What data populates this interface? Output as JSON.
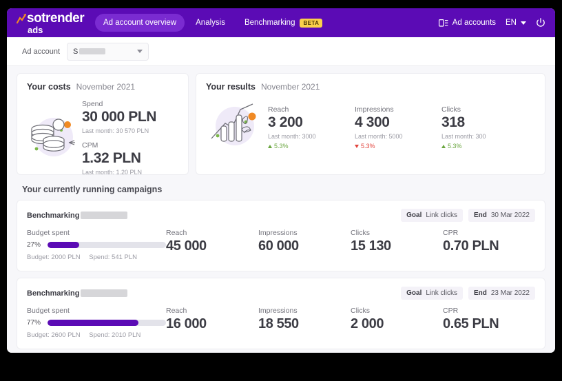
{
  "brand": {
    "logo_main": "sotrender",
    "logo_sub": "ads",
    "accent_purple": "#5b0bb5",
    "accent_orange": "#f08a24",
    "accent_green": "#6aa63f",
    "badge_yellow": "#fbd04b"
  },
  "nav": {
    "items": [
      {
        "label": "Ad account overview",
        "active": true
      },
      {
        "label": "Analysis",
        "active": false
      },
      {
        "label": "Benchmarking",
        "active": false,
        "badge": "BETA"
      }
    ],
    "right": {
      "ad_accounts_label": "Ad accounts",
      "ad_accounts_icon": "list-icon",
      "language": "EN",
      "power_icon": "power-icon"
    }
  },
  "account_bar": {
    "label": "Ad account",
    "selected_prefix": "S",
    "selected_redacted": true
  },
  "costs_card": {
    "title": "Your costs",
    "period": "November 2021",
    "illustration": "coins-illustration",
    "metrics": [
      {
        "label": "Spend",
        "value": "30 000 PLN",
        "sub": "Last month: 30 570 PLN"
      },
      {
        "label": "CPM",
        "value": "1.32 PLN",
        "sub": "Last month: 1.20 PLN"
      }
    ]
  },
  "results_card": {
    "title": "Your results",
    "period": "November 2021",
    "illustration": "growth-chart-illustration",
    "metrics": [
      {
        "label": "Reach",
        "value": "3 200",
        "sub": "Last month: 3000",
        "delta": "5.3%",
        "direction": "up"
      },
      {
        "label": "Impressions",
        "value": "4 300",
        "sub": "Last month: 5000",
        "delta": "5.3%",
        "direction": "down"
      },
      {
        "label": "Clicks",
        "value": "318",
        "sub": "Last month: 300",
        "delta": "5.3%",
        "direction": "up"
      }
    ]
  },
  "campaigns_section": {
    "title": "Your currently running campaigns",
    "goal_label": "Goal",
    "end_label": "End",
    "budget_spent_label": "Budget spent",
    "items": [
      {
        "name": "Benchmarking",
        "name_redacted": true,
        "goal": "Link clicks",
        "end": "30 Mar 2022",
        "percent": "27%",
        "percent_value": 27,
        "budget": "Budget: 2000 PLN",
        "spend": "Spend: 541 PLN",
        "metrics": [
          {
            "label": "Reach",
            "value": "45 000"
          },
          {
            "label": "Impressions",
            "value": "60 000"
          },
          {
            "label": "Clicks",
            "value": "15 130"
          },
          {
            "label": "CPR",
            "value": "0.70 PLN"
          }
        ]
      },
      {
        "name": "Benchmarking",
        "name_redacted": true,
        "goal": "Link clicks",
        "end": "23 Mar 2022",
        "percent": "77%",
        "percent_value": 77,
        "budget": "Budget: 2600 PLN",
        "spend": "Spend: 2010 PLN",
        "metrics": [
          {
            "label": "Reach",
            "value": "16 000"
          },
          {
            "label": "Impressions",
            "value": "18 550"
          },
          {
            "label": "Clicks",
            "value": "2 000"
          },
          {
            "label": "CPR",
            "value": "0.65 PLN"
          }
        ]
      }
    ]
  }
}
